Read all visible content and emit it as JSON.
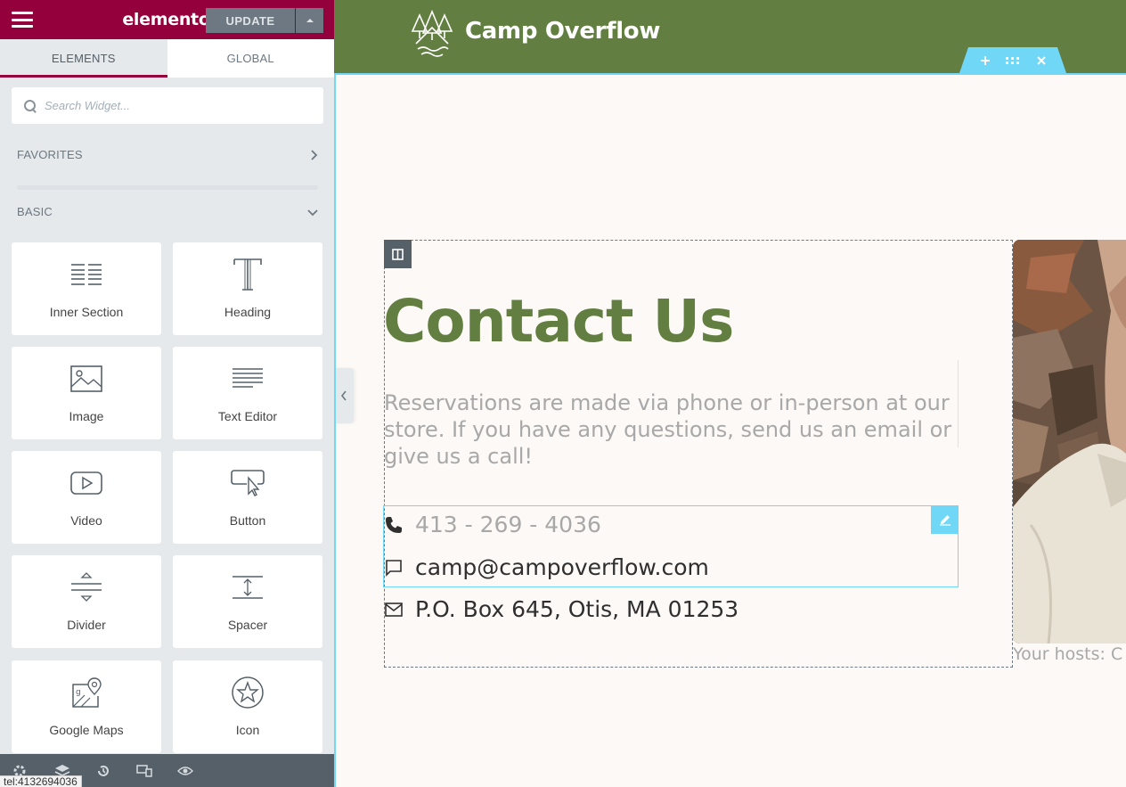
{
  "editor": {
    "brand": "elementor",
    "tabs": [
      {
        "label": "ELEMENTS",
        "active": true
      },
      {
        "label": "GLOBAL",
        "active": false
      }
    ],
    "search": {
      "placeholder": "Search Widget..."
    },
    "categories": {
      "favorites": "FAVORITES",
      "basic": "BASIC"
    },
    "widgets": [
      {
        "label": "Inner Section",
        "icon": "inner-section-icon"
      },
      {
        "label": "Heading",
        "icon": "heading-icon"
      },
      {
        "label": "Image",
        "icon": "image-icon"
      },
      {
        "label": "Text Editor",
        "icon": "text-editor-icon"
      },
      {
        "label": "Video",
        "icon": "video-icon"
      },
      {
        "label": "Button",
        "icon": "button-icon"
      },
      {
        "label": "Divider",
        "icon": "divider-icon"
      },
      {
        "label": "Spacer",
        "icon": "spacer-icon"
      },
      {
        "label": "Google Maps",
        "icon": "google-maps-icon"
      },
      {
        "label": "Icon",
        "icon": "star-icon"
      }
    ],
    "footer": {
      "update_label": "UPDATE"
    },
    "status_url": "tel:4132694036",
    "colors": {
      "brand": "#93003c",
      "panel": "#e6e9ec",
      "accent": "#71d7f7"
    }
  },
  "site": {
    "title": "Camp Overflow",
    "header_color": "#627e41",
    "contact": {
      "heading": "Contact Us",
      "intro": "Reservations are made via phone or in-person at our store. If you have any questions, send us an email or give us a call!",
      "phone": "413 - 269 - 4036",
      "email": "camp@campoverflow.com",
      "address": "P.O. Box 645, Otis, MA 01253"
    },
    "hosts_caption": "Your hosts: C"
  }
}
